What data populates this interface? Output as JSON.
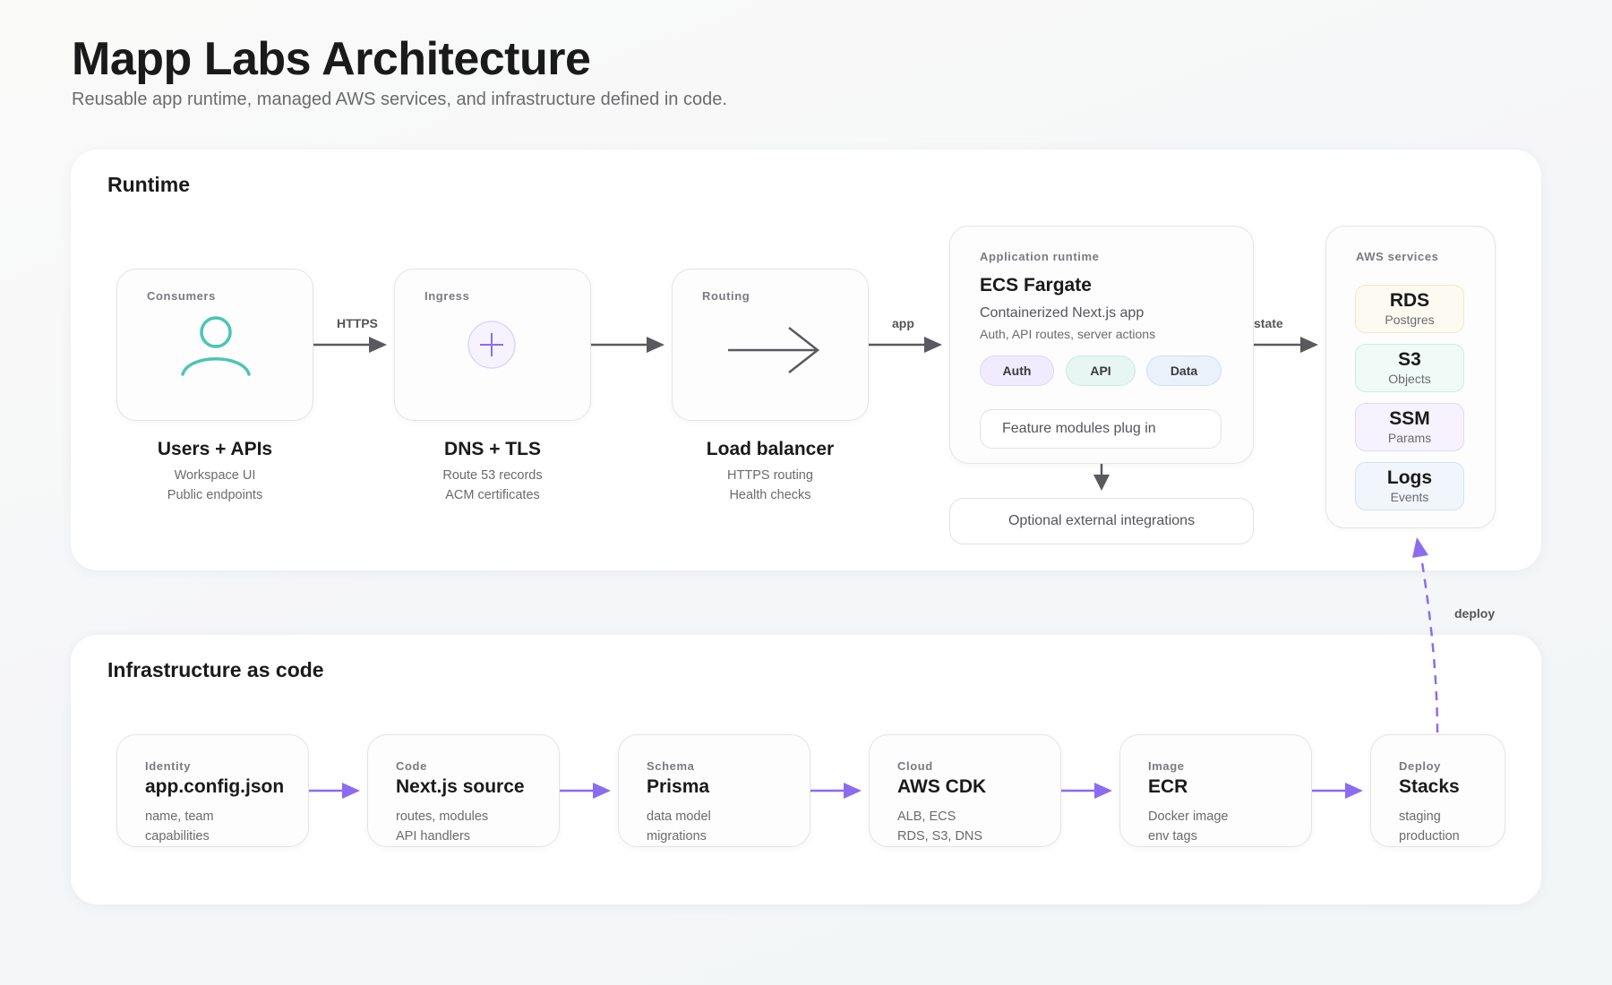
{
  "header": {
    "title": "Mapp Labs Architecture",
    "subtitle": "Reusable app runtime, managed AWS services, and infrastructure defined in code."
  },
  "runtime": {
    "title": "Runtime",
    "nodes": [
      {
        "kicker": "Consumers",
        "title": "Users + APIs",
        "lines": [
          "Workspace UI",
          "Public endpoints"
        ]
      },
      {
        "kicker": "Ingress",
        "title": "DNS + TLS",
        "lines": [
          "Route 53 records",
          "ACM certificates"
        ]
      },
      {
        "kicker": "Routing",
        "title": "Load balancer",
        "lines": [
          "HTTPS routing",
          "Health checks"
        ]
      }
    ],
    "flow_labels": [
      "HTTPS",
      "app",
      "state"
    ],
    "app_runtime": {
      "kicker": "Application runtime",
      "title": "ECS Fargate",
      "description": "Containerized Next.js app",
      "detail": "Auth, API routes, server actions",
      "chips": [
        "Auth",
        "API",
        "Data"
      ],
      "modules": "Feature modules plug in"
    },
    "integrations": "Optional external integrations",
    "aws_services": {
      "kicker": "AWS services",
      "items": [
        {
          "name": "RDS",
          "desc": "Postgres"
        },
        {
          "name": "S3",
          "desc": "Objects"
        },
        {
          "name": "SSM",
          "desc": "Params"
        },
        {
          "name": "Logs",
          "desc": "Events"
        }
      ]
    },
    "deploy_label": "deploy"
  },
  "iac": {
    "title": "Infrastructure as code",
    "steps": [
      {
        "kicker": "Identity",
        "title": "app.config.json",
        "lines": [
          "name, team",
          "capabilities"
        ]
      },
      {
        "kicker": "Code",
        "title": "Next.js source",
        "lines": [
          "routes, modules",
          "API handlers"
        ]
      },
      {
        "kicker": "Schema",
        "title": "Prisma",
        "lines": [
          "data model",
          "migrations"
        ]
      },
      {
        "kicker": "Cloud",
        "title": "AWS CDK",
        "lines": [
          "ALB, ECS",
          "RDS, S3, DNS"
        ]
      },
      {
        "kicker": "Image",
        "title": "ECR",
        "lines": [
          "Docker image",
          "env tags"
        ]
      },
      {
        "kicker": "Deploy",
        "title": "Stacks",
        "lines": [
          "staging",
          "production"
        ]
      }
    ]
  },
  "colors": {
    "accent_purple": "#8b6cf0",
    "consumer_teal": "#4cc4b4",
    "arrow_gray": "#5a5a5e"
  }
}
